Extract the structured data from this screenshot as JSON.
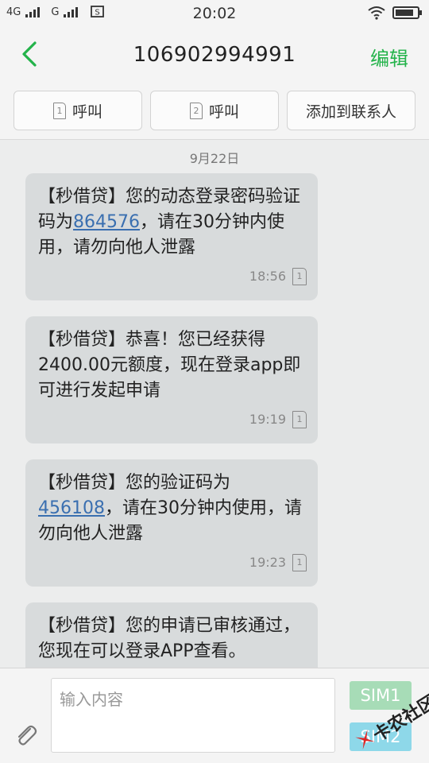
{
  "status_bar": {
    "sim1_network": "4G",
    "sim2_network": "G",
    "time": "20:02"
  },
  "header": {
    "title": "106902994991",
    "edit_label": "编辑"
  },
  "actions": [
    {
      "sim": "1",
      "label": "呼叫"
    },
    {
      "sim": "2",
      "label": "呼叫"
    },
    {
      "label": "添加到联系人"
    }
  ],
  "conversation": {
    "date": "9月22日",
    "messages": [
      {
        "pre": "【秒借贷】您的动态登录密码验证码为",
        "code": "864576",
        "post": "，请在30分钟内使用，请勿向他人泄露",
        "time": "18:56",
        "sim": "1"
      },
      {
        "pre": "【秒借贷】恭喜！您已经获得2400.00元额度，现在登录app即可进行发起申请",
        "code": "",
        "post": "",
        "time": "19:19",
        "sim": "1"
      },
      {
        "pre": "【秒借贷】您的验证码为",
        "code": "456108",
        "post": "，请在30分钟内使用，请勿向他人泄露",
        "time": "19:23",
        "sim": "1"
      },
      {
        "pre": "【秒借贷】您的申请已审核通过，您现在可以登录APP查看。",
        "code": "",
        "post": "",
        "time": "",
        "sim": ""
      }
    ]
  },
  "composer": {
    "placeholder": "输入内容",
    "sim1_label": "SIM1",
    "sim2_label": "SIM2"
  },
  "watermark": {
    "text": "卡农社区"
  },
  "colors": {
    "accent": "#23b34a",
    "bubble": "#d8dbdc",
    "link": "#3a6fb0"
  }
}
